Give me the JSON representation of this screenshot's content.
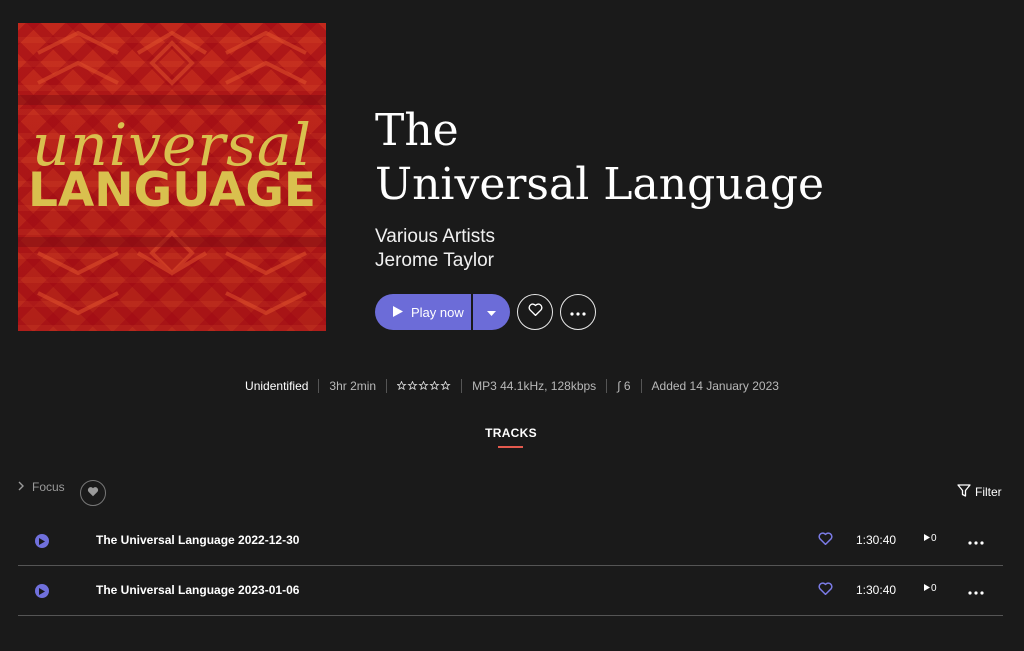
{
  "album": {
    "cover_line1": "universal",
    "cover_line2": "LANGUAGE",
    "title_line1": "The",
    "title_line2": "Universal Language",
    "artist1": "Various Artists",
    "artist2": "Jerome Taylor"
  },
  "controls": {
    "play_label": "Play now"
  },
  "meta": {
    "status": "Unidentified",
    "duration": "3hr 2min",
    "rating_stars": 0,
    "format": "MP3 44.1kHz, 128kbps",
    "versions_count": "6",
    "added": "Added 14 January 2023"
  },
  "tabs": {
    "tracks_label": "TRACKS"
  },
  "toolbar": {
    "focus_label": "Focus",
    "filter_label": "Filter"
  },
  "tracks": [
    {
      "title": "The Universal Language 2022-12-30",
      "duration": "1:30:40",
      "plays": "0"
    },
    {
      "title": "The Universal Language 2023-01-06",
      "duration": "1:30:40",
      "plays": "0"
    }
  ],
  "colors": {
    "accent": "#6c6cd8",
    "tab_underline": "#e45a4e",
    "background": "#1a1a1a"
  }
}
